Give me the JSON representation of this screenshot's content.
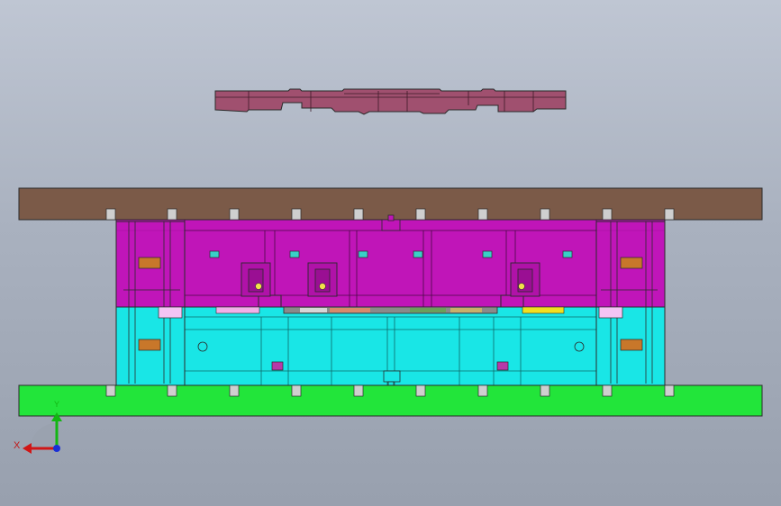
{
  "viewport": {
    "background_top": "#bfc6d3",
    "background_bottom": "#98a0ae"
  },
  "model": {
    "colors": {
      "stripper_plate": "#a0506f",
      "upper_plate": "#7b5a48",
      "punch_holder": "#c015b8",
      "die_block": "#19e6e6",
      "lower_plate": "#22e53a",
      "guide_post": "#c8772a",
      "outline": "#2a2a2a"
    },
    "parts": [
      "stripper-plate",
      "upper-die-shoe",
      "punch-holder",
      "die-block",
      "lower-die-shoe",
      "guide-post-assemblies"
    ]
  },
  "triad": {
    "x_label": "X",
    "y_label": "Y",
    "x_color": "#d01616",
    "y_color": "#13b613",
    "z_color": "#1a2fd6"
  }
}
